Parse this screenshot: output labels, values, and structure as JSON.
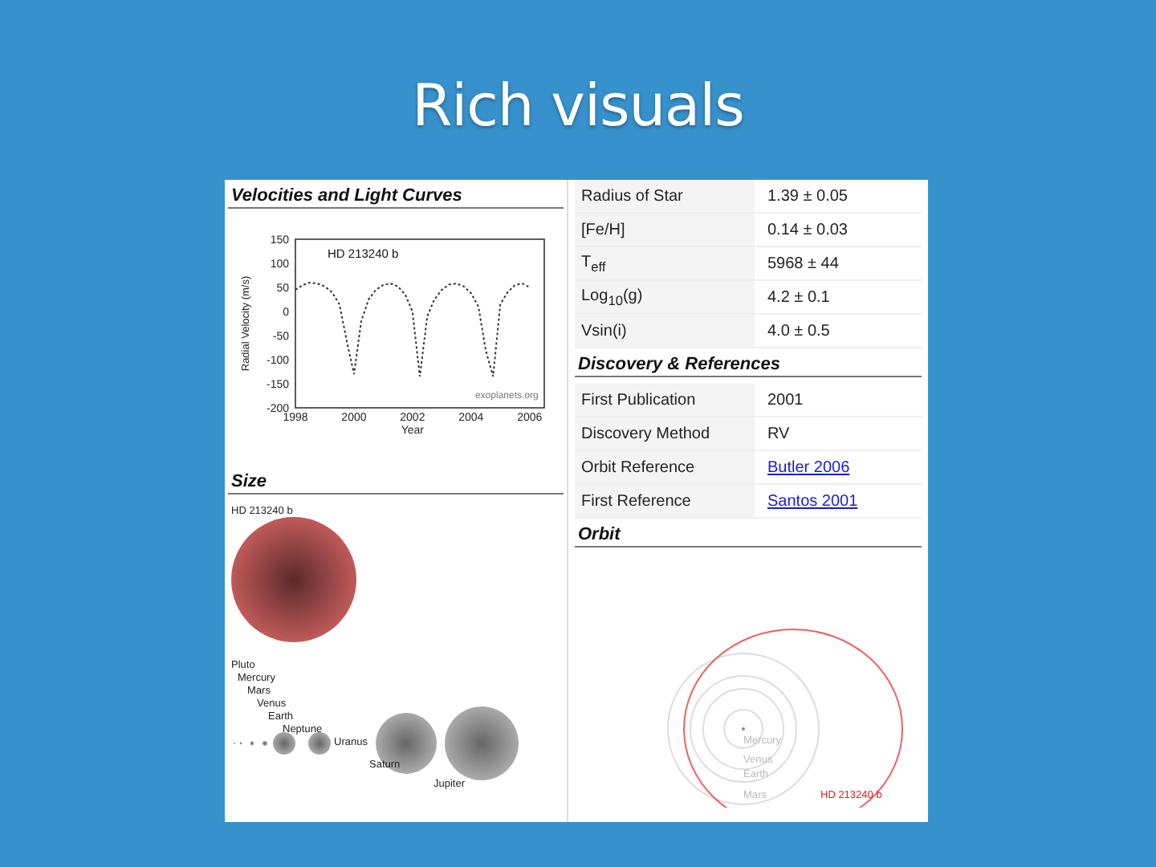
{
  "slide": {
    "title": "Rich visuals"
  },
  "left": {
    "velocity_section": {
      "heading": "Velocities and Light Curves",
      "chart_data": {
        "type": "line",
        "title": "HD 213240 b",
        "xlabel": "Year",
        "ylabel": "Radial Velocity  (m/s)",
        "x": [
          1998,
          1998.25,
          1998.5,
          1998.75,
          1999,
          1999.25,
          1999.5,
          1999.75,
          2000,
          2000.25,
          2000.5,
          2000.75,
          2001,
          2001.25,
          2001.5,
          2001.75,
          2002,
          2002.25,
          2002.5,
          2002.75,
          2003,
          2003.25,
          2003.5,
          2003.75,
          2004,
          2004.25,
          2004.5,
          2004.75,
          2005,
          2005.25,
          2005.5,
          2005.75,
          2006
        ],
        "series": [
          {
            "color": "#333333",
            "line_style": "dashed",
            "values": [
              45,
              55,
              60,
              58,
              52,
              40,
              15,
              -60,
              -130,
              -20,
              25,
              45,
              55,
              58,
              52,
              35,
              0,
              -135,
              -10,
              25,
              45,
              56,
              58,
              52,
              38,
              10,
              -80,
              -135,
              15,
              40,
              55,
              58,
              50
            ]
          }
        ],
        "xlim": [
          1998,
          2006.5
        ],
        "ylim": [
          -200,
          150
        ],
        "xticks": [
          1998,
          2000,
          2002,
          2004,
          2006
        ],
        "yticks": [
          150,
          100,
          50,
          0,
          -50,
          -100,
          -150,
          -200
        ],
        "annotations": [
          "exoplanets.org"
        ]
      }
    },
    "size_section": {
      "heading": "Size",
      "planet_label": "HD 213240 b",
      "solar_labels": [
        "Pluto",
        "Mercury",
        "Mars",
        "Venus",
        "Earth",
        "Neptune",
        "Uranus",
        "Saturn",
        "Jupiter"
      ]
    }
  },
  "right": {
    "star_rows": [
      {
        "label": "Radius of Star",
        "value": "1.39 ± 0.05"
      },
      {
        "label": "[Fe/H]",
        "value": "0.14 ± 0.03"
      },
      {
        "label": "T$_{eff}$",
        "value": "5968 ± 44"
      },
      {
        "label": "Log$_{10}$(g)",
        "value": "4.2 ± 0.1"
      },
      {
        "label": "Vsin(i)",
        "value": "4.0 ± 0.5"
      }
    ],
    "discovery_heading": "Discovery & References",
    "discovery_rows": [
      {
        "label": "First Publication",
        "value": "2001",
        "kind": "text"
      },
      {
        "label": "Discovery Method",
        "value": "RV",
        "kind": "text"
      },
      {
        "label": "Orbit Reference",
        "value": "Butler 2006",
        "kind": "link"
      },
      {
        "label": "First Reference",
        "value": "Santos 2001",
        "kind": "link"
      }
    ],
    "orbit_heading": "Orbit",
    "orbit_labels": [
      "Mercury",
      "Venus",
      "Earth",
      "Mars"
    ],
    "orbit_planet_label": "HD 213240 b"
  }
}
